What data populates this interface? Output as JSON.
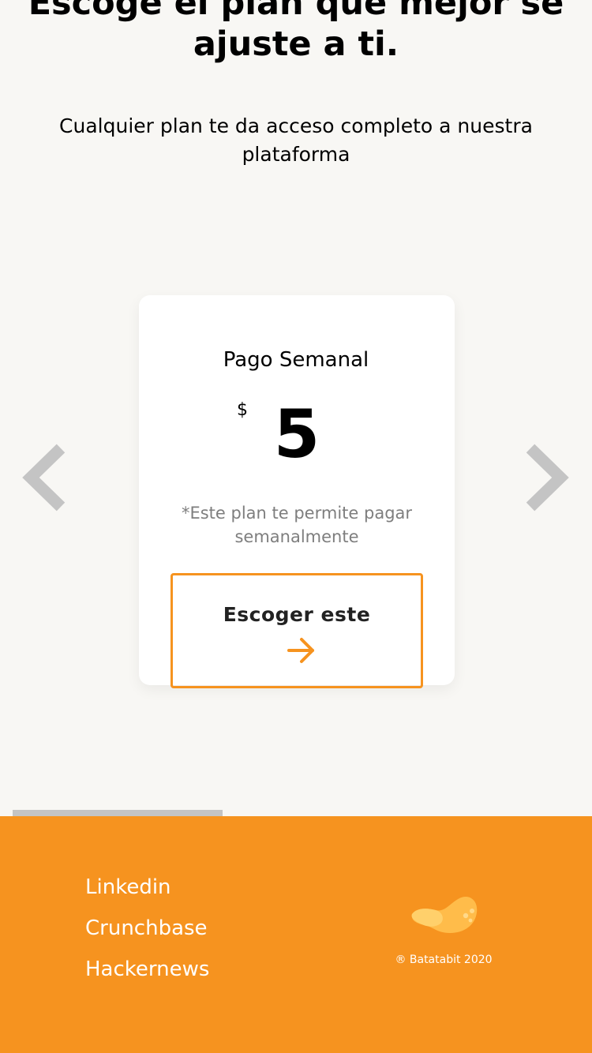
{
  "header": {
    "title": "Escoge el plan que mejor se ajuste a ti.",
    "subtitle": "Cualquier plan te da acceso completo a nuestra plataforma"
  },
  "carousel": {
    "prev_icon": "chevron-left-icon",
    "next_icon": "chevron-right-icon",
    "plan": {
      "name": "Pago Semanal",
      "currency": "$",
      "price": "5",
      "description": "*Este plan te permite pagar semanalmente",
      "button_label": "Escoger este",
      "button_icon": "arrow-right-icon"
    }
  },
  "footer": {
    "links": [
      "Linkedin",
      "Crunchbase",
      "Hackernews"
    ],
    "logo": "batatabit-logo",
    "copyright": "® Batatabit 2020"
  },
  "colors": {
    "accent": "#f6931f",
    "background": "#f8f7f4",
    "card": "#ffffff",
    "muted_text": "#7e7e7e",
    "arrow": "#c4c4c4"
  }
}
